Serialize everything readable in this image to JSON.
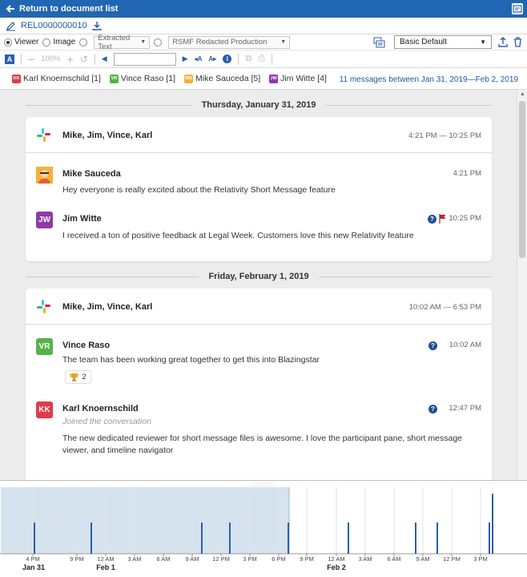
{
  "topbar": {
    "back_label": "Return to document list"
  },
  "document": {
    "id": "REL0000000010"
  },
  "options": {
    "viewer_label": "Viewer",
    "image_label": "Image",
    "extracted_text": "Extracted Text",
    "production": "RSMF Redacted Production",
    "profile": "Basic Default"
  },
  "toolbar": {
    "zoom": "100%"
  },
  "participants": {
    "items": [
      {
        "initials": "KK",
        "label": "Karl Knoernschild [1]",
        "color": "#e03a4a"
      },
      {
        "initials": "VR",
        "label": "Vince Raso [1]",
        "color": "#55b24a"
      },
      {
        "initials": "MS",
        "label": "Mike Sauceda [5]",
        "color": "#f3b13a"
      },
      {
        "initials": "JW",
        "label": "Jim Witte [4]",
        "color": "#8e3aa8"
      }
    ],
    "summary": "11 messages between Jan 31, 2019—Feb 2, 2019"
  },
  "days": [
    {
      "date": "Thursday, January 31, 2019",
      "conversation": {
        "title": "Mike, Jim, Vince, Karl",
        "range": "4:21 PM — 10:25 PM"
      },
      "messages": [
        {
          "author": "Mike Sauceda",
          "time": "4:21 PM",
          "text": "Hey everyone is really excited about the Relativity Short Message feature"
        },
        {
          "author": "Jim Witte",
          "initials": "JW",
          "time": "10:25 PM",
          "text": "I received a ton of positive feedback at Legal Week. Customers love this new Relativity feature"
        }
      ]
    },
    {
      "date": "Friday, February 1, 2019",
      "conversation": {
        "title": "Mike, Jim, Vince, Karl",
        "range": "10:02 AM — 6:53 PM"
      },
      "messages": [
        {
          "author": "Vince Raso",
          "initials": "VR",
          "time": "10:02 AM",
          "text": "The team has been working great together to get this into Blazingstar",
          "reaction_count": "2"
        },
        {
          "author": "Karl Knoernschild",
          "initials": "KK",
          "time": "12:47 PM",
          "subtitle": "Joined the conversation",
          "text": "The new dedicated reviewer for short message files is awesome. I love the participant pane, short message viewer, and timeline navigator"
        }
      ]
    }
  ],
  "timeline": {
    "tick_labels": [
      "4 PM",
      "9 PM",
      "12 AM",
      "3 AM",
      "6 AM",
      "9 AM",
      "12 PM",
      "3 PM",
      "6 PM",
      "9 PM",
      "12 AM",
      "3 AM",
      "6 AM",
      "9 AM",
      "12 PM",
      "3 PM"
    ],
    "day_labels": [
      "Jan 31",
      "Feb 1",
      "Feb 2"
    ],
    "selection_color": "#d6e3ef",
    "bar_color": "#2a5db0"
  },
  "colors": {
    "accent": "#2166b2",
    "link": "#1a5aa6"
  }
}
